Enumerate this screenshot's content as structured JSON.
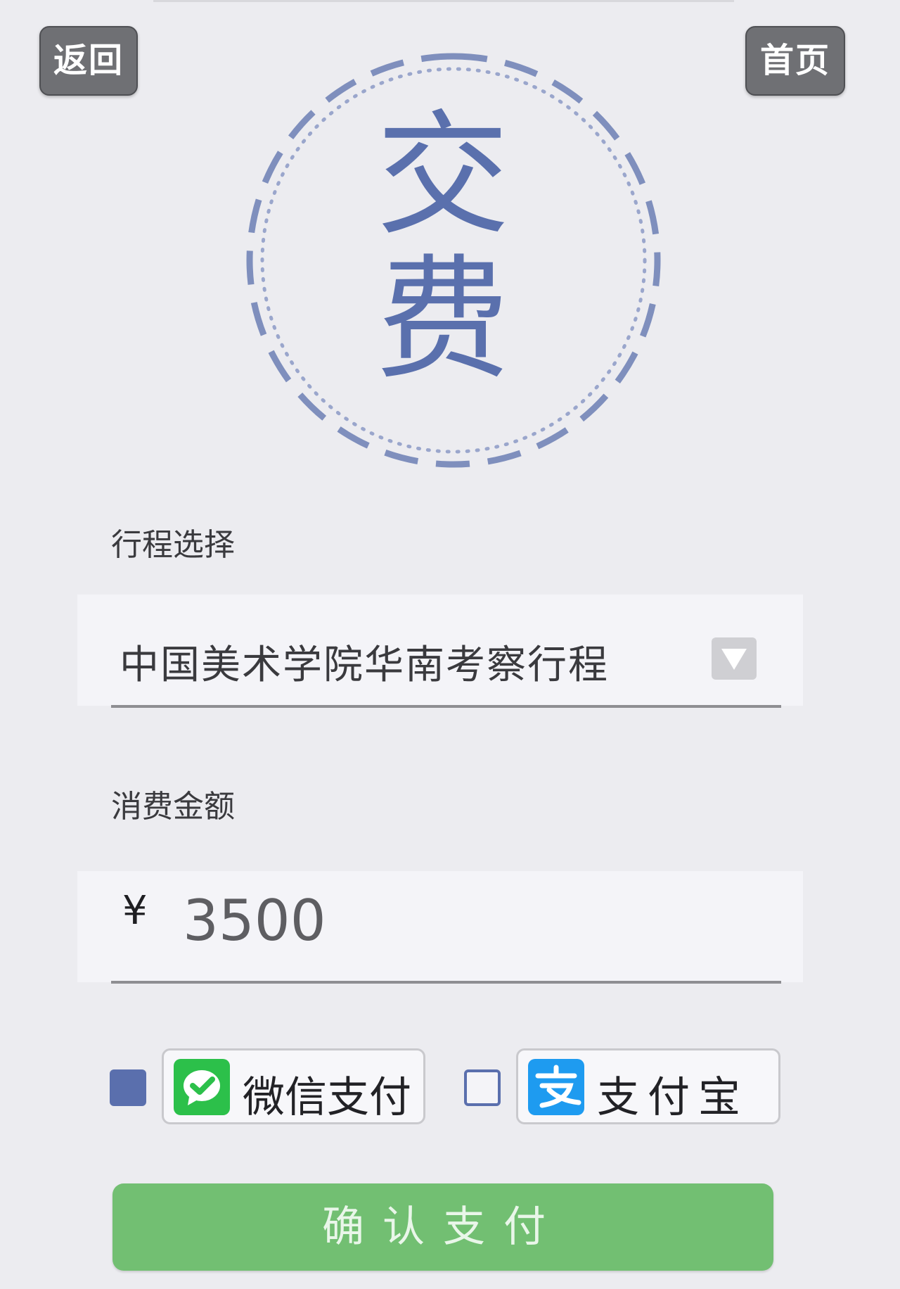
{
  "nav": {
    "back_label": "返回",
    "home_label": "首页"
  },
  "header": {
    "char1": "交",
    "char2": "费"
  },
  "trip": {
    "label": "行程选择",
    "value": "中国美术学院华南考察行程"
  },
  "amount": {
    "label": "消费金额",
    "currency": "¥",
    "value": "3500"
  },
  "payment": {
    "wechat_label": "微信支付",
    "alipay_label": "支付宝",
    "wechat_checked": true,
    "alipay_checked": false
  },
  "confirm": {
    "label": "确认支付"
  },
  "colors": {
    "accent": "#5a70ad",
    "confirm_green": "#72bf72",
    "wechat_green": "#2cc04a",
    "alipay_blue": "#1e9bf0",
    "nav_gray": "#6f7074"
  },
  "icons": {
    "dropdown": "triangle-down-icon",
    "wechat": "wechat-logo-icon",
    "alipay": "alipay-logo-icon"
  }
}
